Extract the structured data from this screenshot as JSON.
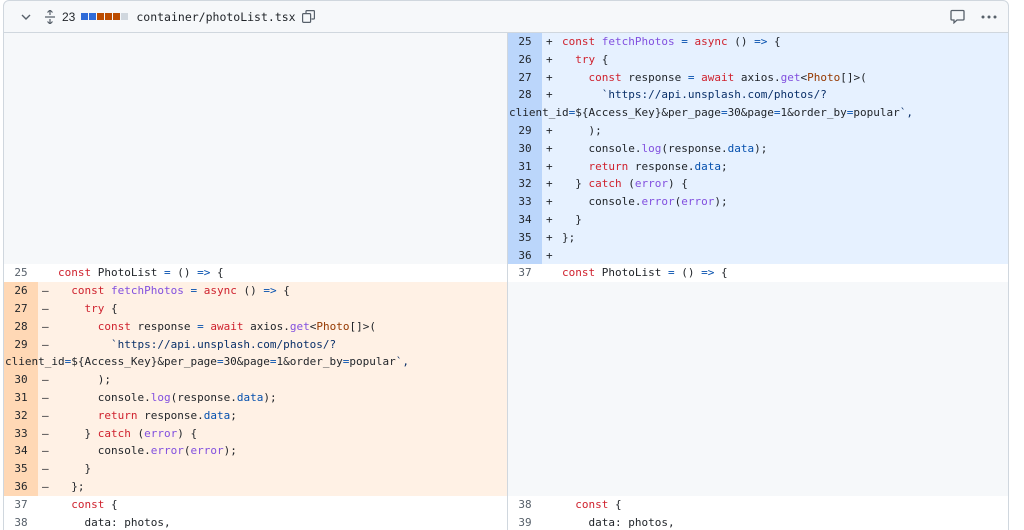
{
  "header": {
    "changes_count": "23",
    "filename": "container/photoList.tsx",
    "diffstat_colors": [
      "#2f6bd8",
      "#2f6bd8",
      "#bc4c00",
      "#bc4c00",
      "#bc4c00",
      "#d0d7de"
    ]
  },
  "colors": {
    "added_bg": "#e6f1ff",
    "added_num_bg": "#bbd6fb",
    "deleted_bg": "#fff1e5",
    "deleted_num_bg": "#ffd8b5"
  },
  "right": {
    "rows": [
      {
        "n": "25",
        "m": "+",
        "c": "const fetchPhotos = async () => {"
      },
      {
        "n": "26",
        "m": "+",
        "c": "  try {"
      },
      {
        "n": "27",
        "m": "+",
        "c": "    const response = await axios.get<Photo[]>("
      },
      {
        "n": "28",
        "m": "+",
        "c": "      `https://api.unsplash.com/photos/?",
        "c2": "client_id=${Access_Key}&per_page=30&page=1&order_by=popular`,"
      },
      {
        "n": "29",
        "m": "+",
        "c": "    );"
      },
      {
        "n": "30",
        "m": "+",
        "c": "    console.log(response.data);"
      },
      {
        "n": "31",
        "m": "+",
        "c": "    return response.data;"
      },
      {
        "n": "32",
        "m": "+",
        "c": "  } catch (error) {"
      },
      {
        "n": "33",
        "m": "+",
        "c": "    console.error(error);"
      },
      {
        "n": "34",
        "m": "+",
        "c": "  }"
      },
      {
        "n": "35",
        "m": "+",
        "c": "};"
      },
      {
        "n": "36",
        "m": "+",
        "c": ""
      },
      {
        "n": "37",
        "m": "",
        "c": "const PhotoList = () => {"
      },
      {
        "n": "38",
        "m": "",
        "c": "  const {"
      },
      {
        "n": "39",
        "m": "",
        "c": "    data: photos,"
      }
    ]
  },
  "left": {
    "rows": [
      {
        "n": "25",
        "m": "",
        "c": "const PhotoList = () => {"
      },
      {
        "n": "26",
        "m": "–",
        "c": "  const fetchPhotos = async () => {"
      },
      {
        "n": "27",
        "m": "–",
        "c": "    try {"
      },
      {
        "n": "28",
        "m": "–",
        "c": "      const response = await axios.get<Photo[]>("
      },
      {
        "n": "29",
        "m": "–",
        "c": "        `https://api.unsplash.com/photos/?",
        "c2": "client_id=${Access_Key}&per_page=30&page=1&order_by=popular`,"
      },
      {
        "n": "30",
        "m": "–",
        "c": "      );"
      },
      {
        "n": "31",
        "m": "–",
        "c": "      console.log(response.data);"
      },
      {
        "n": "32",
        "m": "–",
        "c": "      return response.data;"
      },
      {
        "n": "33",
        "m": "–",
        "c": "    } catch (error) {"
      },
      {
        "n": "34",
        "m": "–",
        "c": "      console.error(error);"
      },
      {
        "n": "35",
        "m": "–",
        "c": "    }"
      },
      {
        "n": "36",
        "m": "–",
        "c": "  };"
      },
      {
        "n": "37",
        "m": "",
        "c": "  const {"
      },
      {
        "n": "38",
        "m": "",
        "c": "    data: photos,"
      }
    ]
  }
}
